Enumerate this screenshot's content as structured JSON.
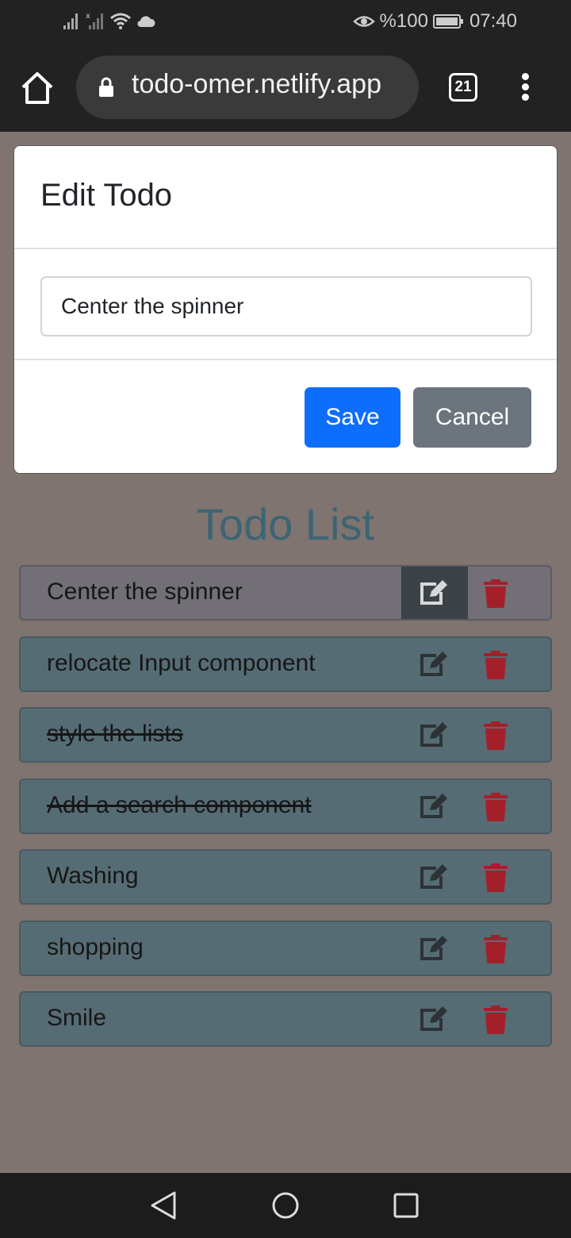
{
  "status_bar": {
    "battery": "%100",
    "time": "07:40",
    "icons": [
      "signal-icon",
      "signal-off-icon",
      "wifi-icon",
      "cloud-icon",
      "eye-icon",
      "battery-icon"
    ]
  },
  "browser": {
    "url": "todo-omer.netlify.app",
    "tab_count": "21"
  },
  "modal": {
    "title": "Edit Todo",
    "input_value": "Center the spinner",
    "save_label": "Save",
    "cancel_label": "Cancel"
  },
  "page": {
    "title": "Todo List"
  },
  "todos": [
    {
      "text": "Center the spinner",
      "completed": false
    },
    {
      "text": "relocate Input component",
      "completed": false
    },
    {
      "text": "style the lists",
      "completed": true
    },
    {
      "text": "Add a search component",
      "completed": true
    },
    {
      "text": "Washing",
      "completed": false
    },
    {
      "text": "shopping",
      "completed": false
    },
    {
      "text": "Smile",
      "completed": false
    }
  ],
  "colors": {
    "primary": "#0d6efd",
    "secondary": "#6c757d",
    "delete": "#a3202b",
    "todo_bg": "#566c74",
    "title": "#3d6475"
  }
}
